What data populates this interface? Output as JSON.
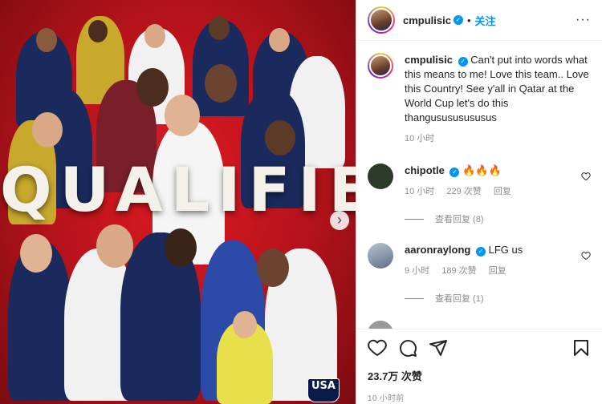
{
  "post": {
    "headline": "QUALIFIED",
    "logo_text": "USA",
    "next_glyph": "›"
  },
  "header": {
    "username": "cmpulisic",
    "separator": "•",
    "follow_label": "关注",
    "more_glyph": "···"
  },
  "caption": {
    "username": "cmpulisic",
    "text": "Can't put into words what this means to me! Love this team.. Love this Country! See y'all in Qatar at the World Cup let's do this thangusususususus",
    "time": "10 小时"
  },
  "comments": [
    {
      "username": "chipotle",
      "text": "🔥🔥🔥",
      "time": "10 小时",
      "likes": "229 次赞",
      "reply_label": "回复",
      "view_replies": "查看回复 (8)",
      "avatar_color": "#2c3a2a"
    },
    {
      "username": "aaronraylong",
      "text": "LFG us",
      "time": "9 小时",
      "likes": "189 次赞",
      "reply_label": "回复",
      "view_replies": "查看回复 (1)",
      "avatar_color": "#7a8fa8"
    }
  ],
  "footer": {
    "likes": "23.7万 次赞",
    "time_ago": "10 小时前"
  },
  "colors": {
    "accent": "#0095f6",
    "post_bg": "#c8141c",
    "jersey_navy": "#1b2a5c"
  }
}
